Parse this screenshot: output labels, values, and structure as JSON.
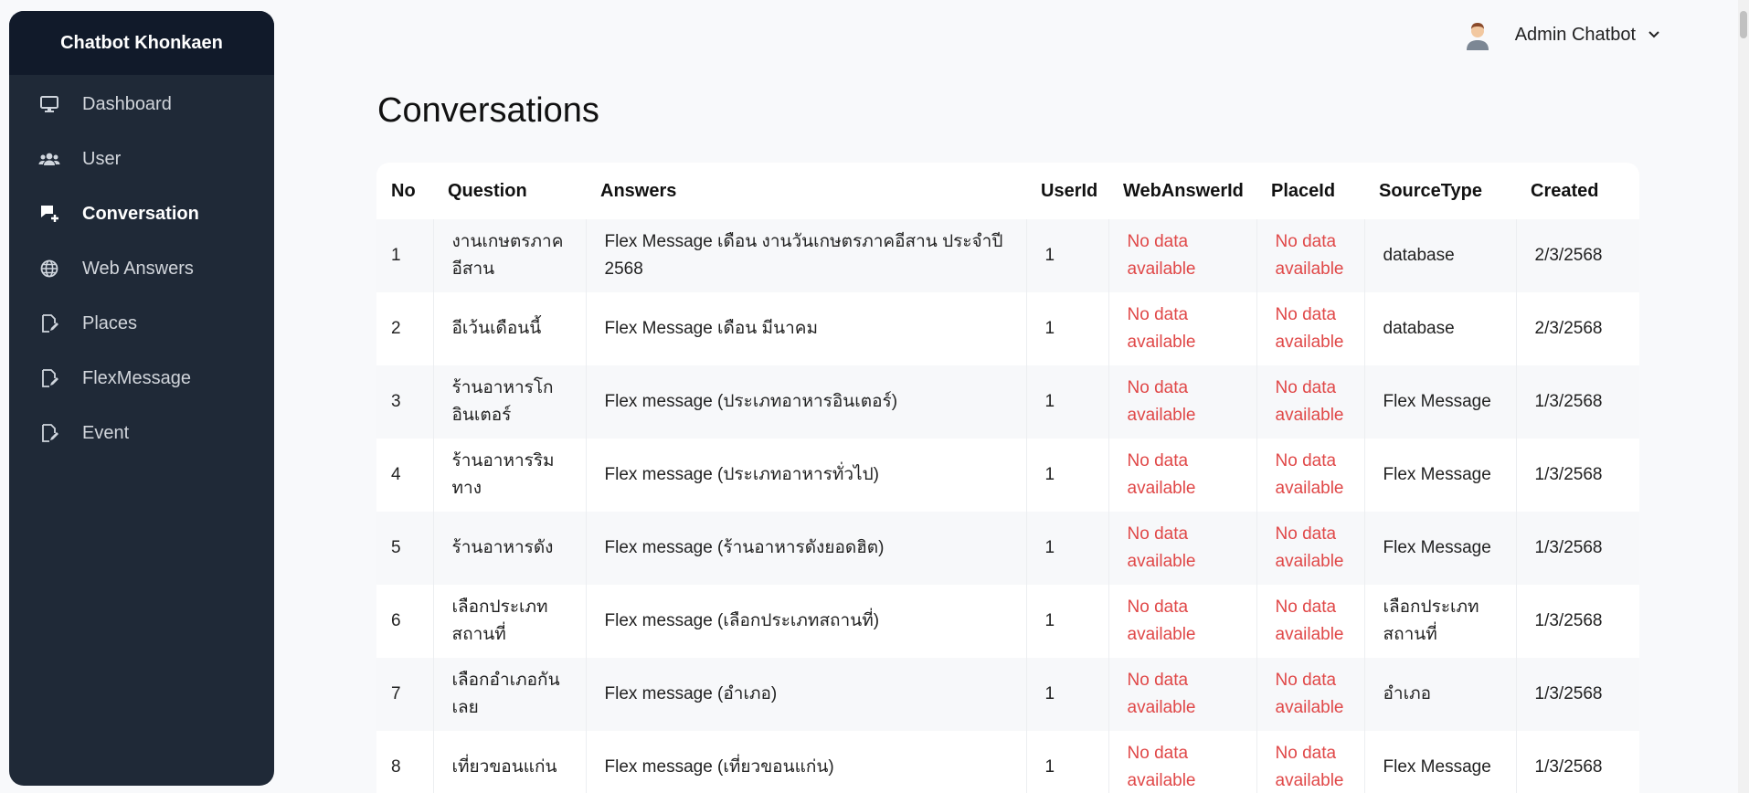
{
  "sidebar": {
    "brand": "Chatbot Khonkaen",
    "items": [
      {
        "label": "Dashboard",
        "icon": "monitor-icon"
      },
      {
        "label": "User",
        "icon": "users-icon"
      },
      {
        "label": "Conversation",
        "icon": "chat-plus-icon"
      },
      {
        "label": "Web Answers",
        "icon": "globe-icon"
      },
      {
        "label": "Places",
        "icon": "file-edit-icon"
      },
      {
        "label": "FlexMessage",
        "icon": "file-edit-icon"
      },
      {
        "label": "Event",
        "icon": "file-edit-icon"
      }
    ],
    "active": "Conversation"
  },
  "topbar": {
    "user_name": "Admin Chatbot"
  },
  "main": {
    "title": "Conversations"
  },
  "table": {
    "columns": [
      "No",
      "Question",
      "Answers",
      "UserId",
      "WebAnswerId",
      "PlaceId",
      "SourceType",
      "Created"
    ],
    "rows": [
      {
        "no": "1",
        "question": "งานเกษตรภาค อีสาน",
        "answer": "Flex Message เดือน งานวันเกษตรภาคอีสาน ประจำปี 2568",
        "user_id": "1",
        "web_answer_id": "No data available",
        "place_id": "No data available",
        "source_type": "database",
        "created": "2/3/2568"
      },
      {
        "no": "2",
        "question": "อีเว้นเดือนนี้",
        "answer": "Flex Message เดือน มีนาคม",
        "user_id": "1",
        "web_answer_id": "No data available",
        "place_id": "No data available",
        "source_type": "database",
        "created": "2/3/2568"
      },
      {
        "no": "3",
        "question": "ร้านอาหารโก อินเตอร์",
        "answer": "Flex message (ประเภทอาหารอินเตอร์)",
        "user_id": "1",
        "web_answer_id": "No data available",
        "place_id": "No data available",
        "source_type": "Flex Message",
        "created": "1/3/2568"
      },
      {
        "no": "4",
        "question": "ร้านอาหารริม ทาง",
        "answer": "Flex message (ประเภทอาหารทั่วไป)",
        "user_id": "1",
        "web_answer_id": "No data available",
        "place_id": "No data available",
        "source_type": "Flex Message",
        "created": "1/3/2568"
      },
      {
        "no": "5",
        "question": "ร้านอาหารดัง",
        "answer": "Flex message (ร้านอาหารดังยอดฮิต)",
        "user_id": "1",
        "web_answer_id": "No data available",
        "place_id": "No data available",
        "source_type": "Flex Message",
        "created": "1/3/2568"
      },
      {
        "no": "6",
        "question": "เลือกประเภท สถานที่",
        "answer": "Flex message (เลือกประเภทสถานที่)",
        "user_id": "1",
        "web_answer_id": "No data available",
        "place_id": "No data available",
        "source_type": "เลือกประเภท สถานที่",
        "created": "1/3/2568"
      },
      {
        "no": "7",
        "question": "เลือกอำเภอกัน เลย",
        "answer": "Flex message (อำเภอ)",
        "user_id": "1",
        "web_answer_id": "No data available",
        "place_id": "No data available",
        "source_type": "อำเภอ",
        "created": "1/3/2568"
      },
      {
        "no": "8",
        "question": "เที่ยวขอนแก่น",
        "answer": "Flex message (เที่ยวขอนแก่น)",
        "user_id": "1",
        "web_answer_id": "No data available",
        "place_id": "No data available",
        "source_type": "Flex Message",
        "created": "1/3/2568"
      }
    ]
  }
}
